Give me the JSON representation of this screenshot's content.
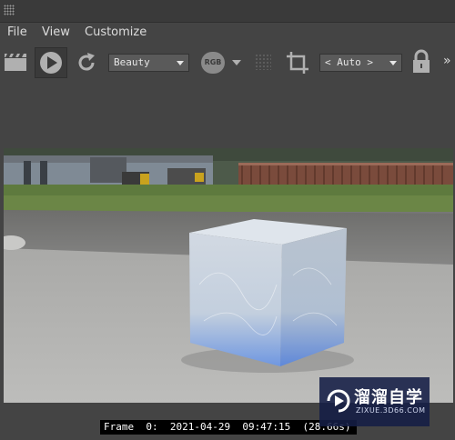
{
  "menu": {
    "file": "File",
    "view": "View",
    "customize": "Customize"
  },
  "toolbar": {
    "render_element": "Beauty",
    "channel_button": "RGB",
    "region_mode": "< Auto >",
    "more": "»"
  },
  "status": {
    "frame_info": "Frame  0:  2021-04-29  09:47:15  (28.66s)"
  },
  "watermark": {
    "logo_text": "溜溜自学",
    "url": "ZIXUE.3D66.COM"
  },
  "colors": {
    "panel_bg": "#444444",
    "dropdown_bg": "#5a5a5a",
    "icon_color": "#b0b0b0",
    "watermark_bg": "#141e46"
  }
}
